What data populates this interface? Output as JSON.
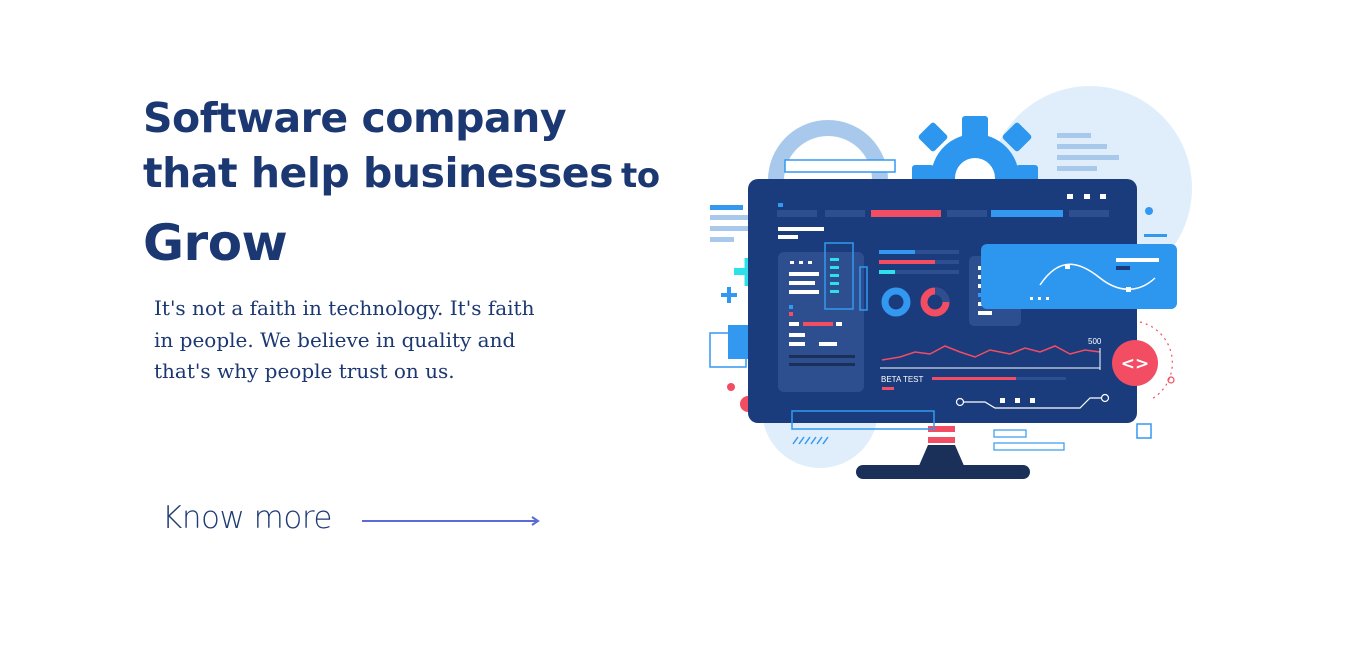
{
  "hero": {
    "headline_line1": "Software company",
    "headline_line2_main": "that help businesses",
    "headline_line2_small": "to",
    "headline_line3": "Grow",
    "description": "It's not a faith in technology. It's faith in people. We believe in quality and that's why people trust on us.",
    "cta_label": "Know more"
  },
  "illustration": {
    "code_badge": "<>",
    "chart_label": "BETA TEST",
    "chart_value": "500"
  },
  "colors": {
    "navy": "#1c3872",
    "monitor": "#1a3b7c",
    "accent_blue": "#3399f0",
    "accent_red": "#f24d63",
    "light_blue": "#e0eefc",
    "arrow": "#5b6bd6"
  }
}
